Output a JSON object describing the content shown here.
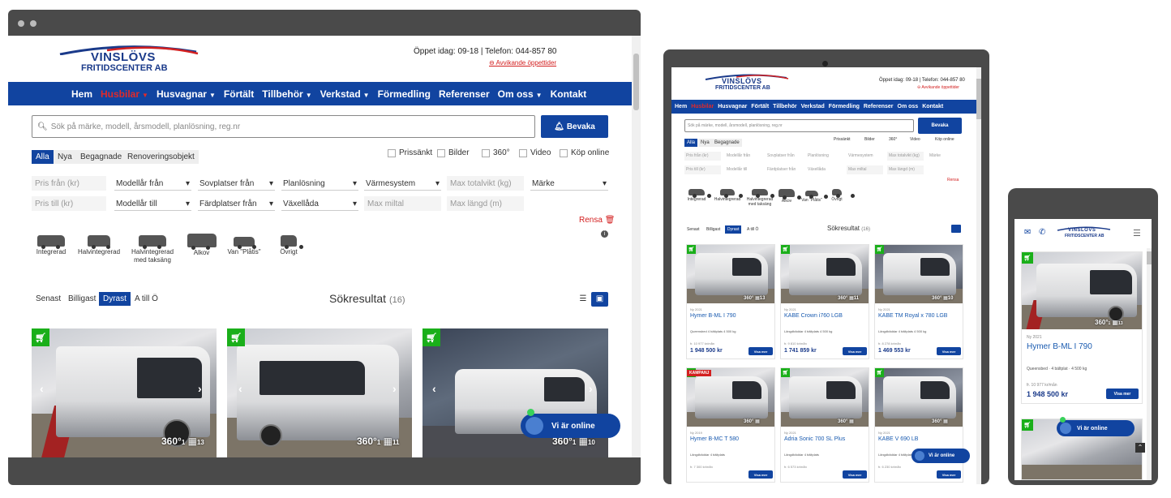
{
  "site": {
    "logo_top": "VINSLÖVS",
    "logo_bottom": "FRITIDSCENTER AB",
    "hours": "Öppet idag: 09-18 | Telefon: 044-857 80",
    "deviating_hours": "Avvikande öppettider",
    "hours_short": "Öppet idag: 09-18 | Telefon: 044-857 80"
  },
  "nav": {
    "items": [
      "Hem",
      "Husbilar",
      "Husvagnar",
      "Förtält",
      "Tillbehör",
      "Verkstad",
      "Förmedling",
      "Referenser",
      "Om oss",
      "Kontakt"
    ]
  },
  "search": {
    "placeholder": "Sök på märke, modell, årsmodell, planlösning, reg.nr",
    "button": "Bevaka"
  },
  "condition_tabs": [
    "Alla",
    "Nya",
    "Begagnade",
    "Renoveringsobjekt"
  ],
  "checkboxes": [
    "Prissänkt",
    "Bilder",
    "360°",
    "Video",
    "Köp online"
  ],
  "filters_row1": [
    "Pris från (kr)",
    "Modellår från",
    "Sovplatser från",
    "Planlösning",
    "Värmesystem",
    "Max totalvikt (kg)",
    "Märke"
  ],
  "filters_row2": [
    "Pris till (kr)",
    "Modellår till",
    "Färdplatser från",
    "Växellåda",
    "Max miltal",
    "Max längd (m)"
  ],
  "clear": "Rensa",
  "vehicle_types": [
    "Integrerad",
    "Halvintegrerad",
    "Halvintegrerad med taksäng",
    "Alkov",
    "Van \"Plåtis\"",
    "Övrigt"
  ],
  "sort": [
    "Senast",
    "Billigast",
    "Dyrast",
    "A till Ö"
  ],
  "results": {
    "label": "Sökresultat",
    "count": "(16)"
  },
  "listings": [
    {
      "year": "Ny 2021",
      "title": "Hymer B-ML I 790",
      "specs": "Queensbed  4 bältplats  4 500 kg",
      "monthly": "fr. 10 977 kr/mån",
      "price": "1 948 500 kr",
      "photos": "13",
      "campaign": ""
    },
    {
      "year": "Ny 2021",
      "title": "KABE Crown i760 LGB",
      "specs": "Längdbäddar  4 bältplats  4 500 kg",
      "monthly": "fr. 9 810 kr/mån",
      "price": "1 741 859 kr",
      "photos": "11",
      "campaign": ""
    },
    {
      "year": "Ny 2021",
      "title": "KABE TM Royal x 780 LGB",
      "specs": "Längdbäddar  4 bältplats  4 500 kg",
      "monthly": "fr. 8 278 kr/mån",
      "price": "1 469 553 kr",
      "photos": "10",
      "campaign": ""
    },
    {
      "year": "Ny 2019",
      "title": "Hymer B-MC T 580",
      "specs": "Längdbäddar  4 bältplats",
      "monthly": "fr. 7 300 kr/mån",
      "price": "",
      "photos": "",
      "campaign": "KAMPANJ"
    },
    {
      "year": "Ny 2021",
      "title": "Adria Sonic 700 SL Plus",
      "specs": "Längdbäddar  4 bältplats",
      "monthly": "fr. 6 573 kr/mån",
      "price": "",
      "photos": "",
      "campaign": ""
    },
    {
      "year": "Ny 2021",
      "title": "KABE V 690 LB",
      "specs": "Längdbäddar  4 bältplats",
      "monthly": "fr. 6 230 kr/mån",
      "price": "",
      "photos": "",
      "campaign": ""
    }
  ],
  "card_label": {
    "three_sixty": "360°",
    "one": "1",
    "show_more": "Visa mer"
  },
  "chat": {
    "label": "Vi är online"
  },
  "mobile": {
    "title": "Hymer B-ML I 790",
    "year": "Ny 2021",
    "specs_a": "Queensbed",
    "specs_b": "4 bältplat",
    "specs_c": "4 500 kg",
    "monthly": "fr. 10 977 kr/mån",
    "price": "1 948 500 kr",
    "show_more": "Visa mer"
  },
  "colors": {
    "brand_blue": "#1144a0",
    "accent_red": "#e02a2a",
    "cart_green": "#1aaf1a"
  }
}
